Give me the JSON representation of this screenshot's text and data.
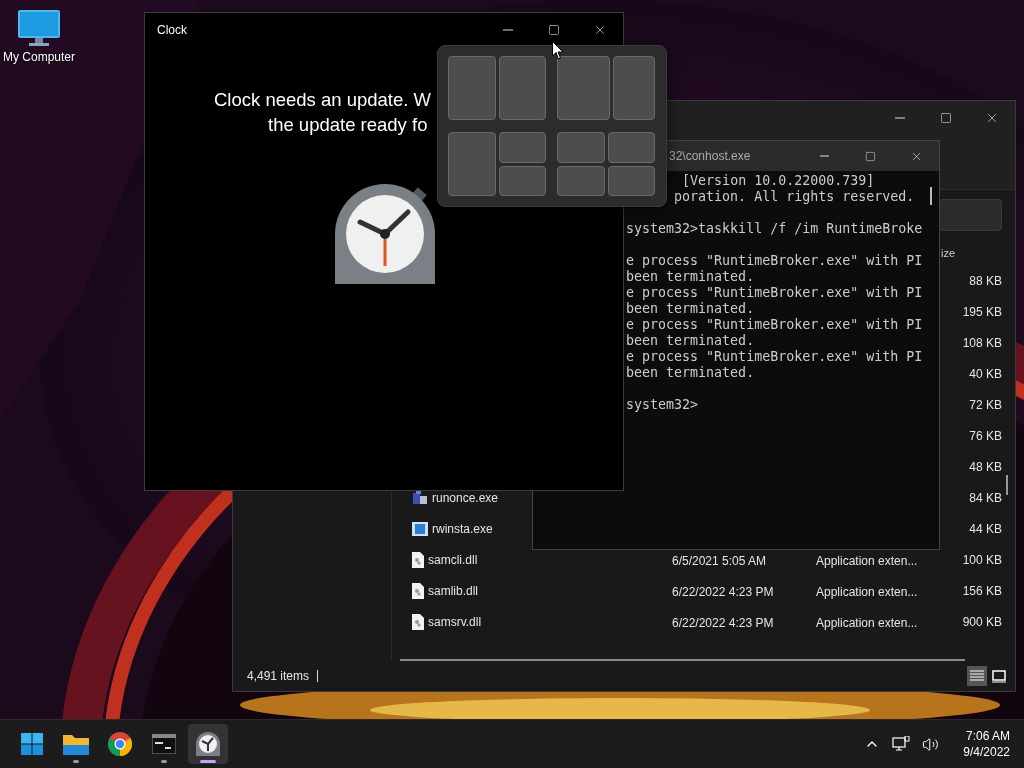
{
  "desktop_icons": [
    {
      "label": "My Computer"
    }
  ],
  "explorer": {
    "size_header": "ize",
    "rows": [
      {
        "size": "88 KB"
      },
      {
        "size": "195 KB"
      },
      {
        "size": "108 KB"
      },
      {
        "size": "40 KB"
      },
      {
        "size": "72 KB"
      },
      {
        "size": "76 KB"
      },
      {
        "size": "48 KB"
      },
      {
        "name": "runonce.exe",
        "kind": "setup",
        "size": "84 KB"
      },
      {
        "name": "rwinsta.exe",
        "kind": "app",
        "size": "44 KB"
      },
      {
        "name": "samcli.dll",
        "kind": "dll",
        "date": "6/5/2021 5:05 AM",
        "type": "Application exten...",
        "size": "100 KB"
      },
      {
        "name": "samlib.dll",
        "kind": "dll",
        "date": "6/22/2022 4:23 PM",
        "type": "Application exten...",
        "size": "156 KB"
      },
      {
        "name": "samsrv.dll",
        "kind": "dll",
        "date": "6/22/2022 4:23 PM",
        "type": "Application exten...",
        "size": "900 KB"
      }
    ],
    "status": "4,491 items",
    "views": [
      {
        "kind": "details",
        "selected": true
      },
      {
        "kind": "tiles",
        "selected": false
      }
    ]
  },
  "console": {
    "title": "32\\conhost.exe",
    "lines": [
      {
        "kind": "version",
        "text": "[Version 10.0.22000.739]"
      },
      {
        "kind": "copyright",
        "text": "poration. All rights reserved."
      },
      {
        "kind": "block",
        "text": "system32>taskkill /f /im RuntimeBroke"
      },
      {
        "kind": "block",
        "text": "e process \"RuntimeBroker.exe\" with PI"
      },
      {
        "kind": "line",
        "text": "been terminated."
      },
      {
        "kind": "line",
        "text": "e process \"RuntimeBroker.exe\" with PI"
      },
      {
        "kind": "line",
        "text": "been terminated."
      },
      {
        "kind": "line",
        "text": "e process \"RuntimeBroker.exe\" with PI"
      },
      {
        "kind": "line",
        "text": "been terminated."
      },
      {
        "kind": "line",
        "text": "e process \"RuntimeBroker.exe\" with PI"
      },
      {
        "kind": "line",
        "text": "been terminated."
      },
      {
        "kind": "block",
        "text": "system32>"
      }
    ]
  },
  "clock_app": {
    "title": "Clock",
    "message": [
      "Clock needs an update. W",
      "the update ready fo"
    ]
  },
  "snap_layouts": [
    {
      "kind": "halves"
    },
    {
      "kind": "wide-left"
    },
    {
      "kind": "main-stack"
    },
    {
      "kind": "quad"
    }
  ],
  "taskbar": {
    "apps": [
      {
        "kind": "start",
        "running": false,
        "selected": false
      },
      {
        "kind": "explorer",
        "running": true,
        "selected": false
      },
      {
        "kind": "chrome",
        "running": false,
        "selected": false
      },
      {
        "kind": "terminal",
        "running": true,
        "selected": false
      },
      {
        "kind": "clock",
        "running": true,
        "selected": true
      }
    ],
    "time": "7:06 AM",
    "date": "9/4/2022"
  }
}
